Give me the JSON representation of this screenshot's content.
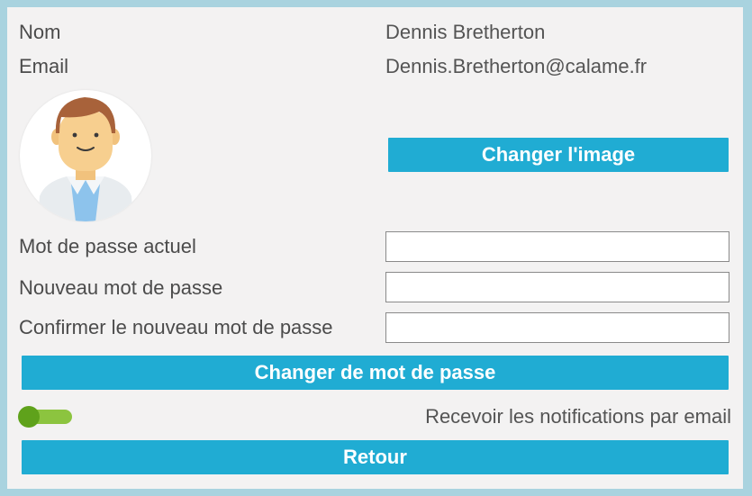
{
  "profile": {
    "name_label": "Nom",
    "name_value": "Dennis Bretherton",
    "email_label": "Email",
    "email_value": "Dennis.Bretherton@calame.fr",
    "avatar_icon": "doctor-avatar-icon",
    "change_image_button": "Changer l'image"
  },
  "password": {
    "current_label": "Mot de passe actuel",
    "current_value": "",
    "new_label": "Nouveau mot de passe",
    "new_value": "",
    "confirm_label": "Confirmer le nouveau mot de passe",
    "confirm_value": "",
    "change_button": "Changer de mot de passe"
  },
  "notifications": {
    "label": "Recevoir les notifications par email",
    "enabled": true
  },
  "footer": {
    "back_button": "Retour"
  },
  "colors": {
    "accent": "#20acd3",
    "toggle_on": "#8cc43f",
    "panel_bg": "#f3f2f2",
    "frame_bg": "#a9d3df"
  }
}
